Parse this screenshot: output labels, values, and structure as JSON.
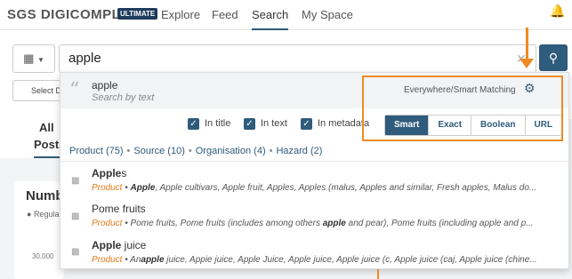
{
  "topbar": {
    "logo": "SGS DIGICOMPLY",
    "badge": "ULTIMATE",
    "nav": [
      "Explore",
      "Feed",
      "Search",
      "My Space"
    ],
    "active_nav": "Search"
  },
  "search": {
    "value": "apple",
    "filter_icon": "filter-icon",
    "search_icon": "magnifier-icon",
    "select_date": "Select D"
  },
  "left": {
    "tab_all": "All",
    "tab_posts": "Posts",
    "card_title": "Numb",
    "legend": "Regula",
    "axis_tick": "30,000"
  },
  "dropdown": {
    "suggestion": {
      "term": "apple",
      "sub": "Search by text"
    },
    "scope_label": "Everywhere/Smart Matching",
    "checkboxes": [
      {
        "label": "In title",
        "checked": true
      },
      {
        "label": "In text",
        "checked": true
      },
      {
        "label": "In metadata",
        "checked": true
      }
    ],
    "modes": [
      "Smart",
      "Exact",
      "Boolean",
      "URL"
    ],
    "active_mode": "Smart",
    "facets": [
      "Product (75)",
      "Source (10)",
      "Organisation (4)",
      "Hazard (2)"
    ],
    "results": [
      {
        "title_bold": "Apple",
        "title_rest": "s",
        "type": "Product",
        "desc_bold": "Apple",
        "desc": ", Apple cultivars, Apple fruit, Apples, Apples (malus, Apples and similar, Fresh apples, Malus do..."
      },
      {
        "title_bold": "",
        "title_rest": "Pome fruits",
        "type": "Product",
        "desc_pre": " • Pome fruits, Pome fruits (includes among others ",
        "desc_bold": "apple",
        "desc": " and pear), Pome fruits (including apple and p..."
      },
      {
        "title_bold": "Apple",
        "title_rest": " juice",
        "type": "Product",
        "desc_pre": " • An",
        "desc_bold": "apple",
        "desc": " juice, Appie juice, Apple Juice, Apple juice, Apple juice (c, Apple juice (caj, Apple juice (chine..."
      }
    ]
  },
  "colors": {
    "accent": "#2f5b7c",
    "annotation": "#f08a24",
    "product_tag": "#e07a1a"
  }
}
